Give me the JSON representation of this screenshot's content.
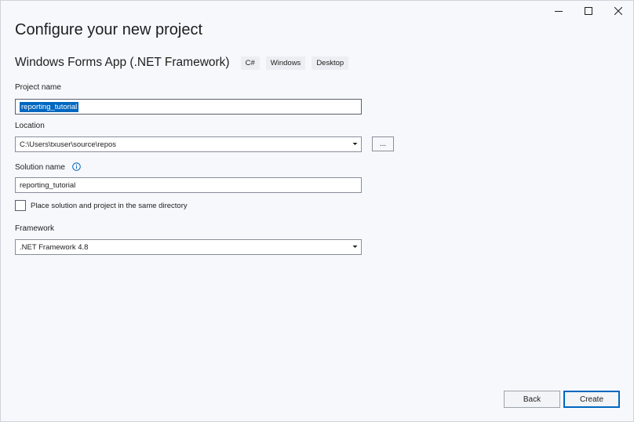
{
  "window": {
    "controls": {
      "minimize_icon": "minimize-icon",
      "maximize_icon": "maximize-icon",
      "close_icon": "close-icon"
    }
  },
  "heading": "Configure your new project",
  "template": {
    "name": "Windows Forms App (.NET Framework)",
    "tags": [
      "C#",
      "Windows",
      "Desktop"
    ]
  },
  "project_name": {
    "label": "Project name",
    "value": "reporting_tutorial"
  },
  "location": {
    "label": "Location",
    "value": "C:\\Users\\txuser\\source\\repos",
    "browse_label": "..."
  },
  "solution_name": {
    "label": "Solution name",
    "value": "reporting_tutorial",
    "info_icon": "info-icon"
  },
  "same_directory": {
    "label": "Place solution and project in the same directory",
    "checked": false
  },
  "framework": {
    "label": "Framework",
    "selected": ".NET Framework 4.8"
  },
  "buttons": {
    "back": "Back",
    "create": "Create"
  },
  "colors": {
    "accent": "#0067c0",
    "background": "#f7f8fc"
  }
}
